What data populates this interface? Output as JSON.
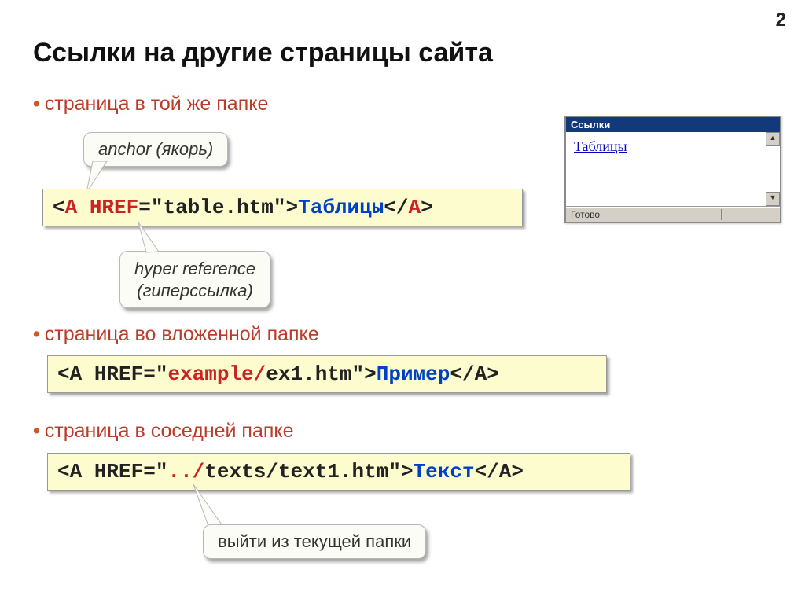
{
  "page_number": "2",
  "title": "Ссылки на другие страницы сайта",
  "bullets": {
    "b1": "страница в той же папке",
    "b2": "страница во вложенной папке",
    "b3": "страница в соседней папке"
  },
  "callouts": {
    "anchor": "anchor (якорь)",
    "href1": "hyper reference",
    "href2": "(гиперссылка)",
    "exit": "выйти из текущей папки"
  },
  "code1": {
    "open": "<",
    "tag": "A",
    "sp": " ",
    "attr": "HREF",
    "eq": "=",
    "val": "\"table.htm\"",
    "gt": ">",
    "text": "Таблицы",
    "close1": "</",
    "close2": "A",
    "close3": ">"
  },
  "code2": {
    "open": "<",
    "tag": "A",
    "sp": " ",
    "attr": "HREF",
    "eq": "=",
    "q1": "\"",
    "path_hl": "example/",
    "path_rest": "ex1.htm",
    "q2": "\"",
    "gt": ">",
    "text": "Пример",
    "close1": "</",
    "close2": "A",
    "close3": ">"
  },
  "code3": {
    "open": "<",
    "tag": "A",
    "sp": " ",
    "attr": "HREF",
    "eq": "=",
    "q1": "\"",
    "path_hl": "../",
    "path_rest": "texts/text1.htm",
    "q2": "\"",
    "gt": ">",
    "text": "Текст",
    "close1": "</",
    "close2": "A",
    "close3": ">"
  },
  "browser": {
    "title": "Ссылки",
    "link": "Таблицы",
    "status": "Готово"
  }
}
